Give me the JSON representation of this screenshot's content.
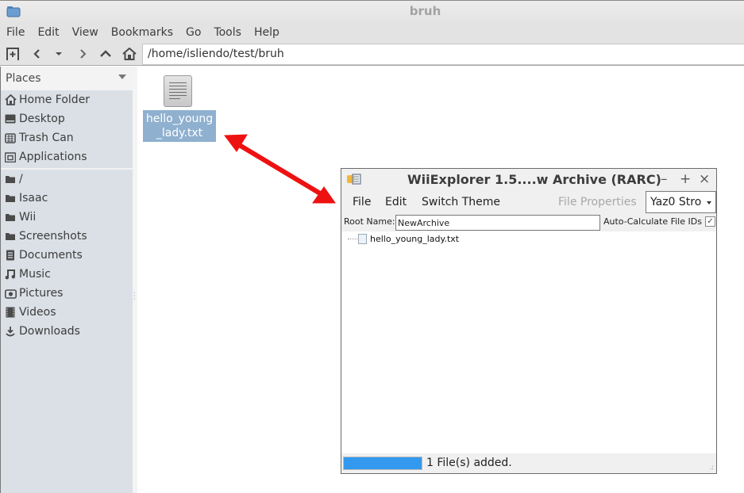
{
  "file_manager": {
    "window_title": "bruh",
    "menu": [
      "File",
      "Edit",
      "View",
      "Bookmarks",
      "Go",
      "Tools",
      "Help"
    ],
    "toolbar": {
      "buttons": [
        "new-tab",
        "back",
        "history-dropdown",
        "forward",
        "up",
        "home"
      ]
    },
    "location": "/home/isliendo/test/bruh",
    "sidebar": {
      "header": "Places",
      "items": [
        {
          "label": "Home Folder",
          "icon": "home-icon"
        },
        {
          "label": "Desktop",
          "icon": "desktop-icon"
        },
        {
          "label": "Trash Can",
          "icon": "trash-icon"
        },
        {
          "label": "Applications",
          "icon": "applications-icon"
        }
      ],
      "bookmarks": [
        {
          "label": "/",
          "icon": "folder-icon"
        },
        {
          "label": "Isaac",
          "icon": "folder-icon"
        },
        {
          "label": "Wii",
          "icon": "folder-icon"
        },
        {
          "label": "Screenshots",
          "icon": "folder-icon"
        },
        {
          "label": "Documents",
          "icon": "documents-icon"
        },
        {
          "label": "Music",
          "icon": "music-icon"
        },
        {
          "label": "Pictures",
          "icon": "pictures-icon"
        },
        {
          "label": "Videos",
          "icon": "videos-icon"
        },
        {
          "label": "Downloads",
          "icon": "downloads-icon"
        }
      ]
    },
    "files": [
      {
        "name_line1": "hello_young",
        "name_line2": "_lady.txt",
        "selected": true
      }
    ]
  },
  "wii_explorer": {
    "window_title": "WiiExplorer 1.5....w Archive (RARC)",
    "controls": {
      "minimize": "–",
      "maximize": "+",
      "close": "×"
    },
    "menu": {
      "file": "File",
      "edit": "Edit",
      "switch_theme": "Switch Theme",
      "file_properties": "File Properties"
    },
    "compression_select": "Yaz0 Stro",
    "root_name_label": "Root Name:",
    "root_name_value": "NewArchive",
    "auto_calc_label": "Auto-Calculate File IDs",
    "auto_calc_checked": true,
    "check_mark": "✓",
    "tree": [
      {
        "name": "hello_young_lady.txt"
      }
    ],
    "progress_percent": 100,
    "status_text": "1 File(s) added."
  },
  "annotation": {
    "arrow_color": "#ee1111"
  }
}
